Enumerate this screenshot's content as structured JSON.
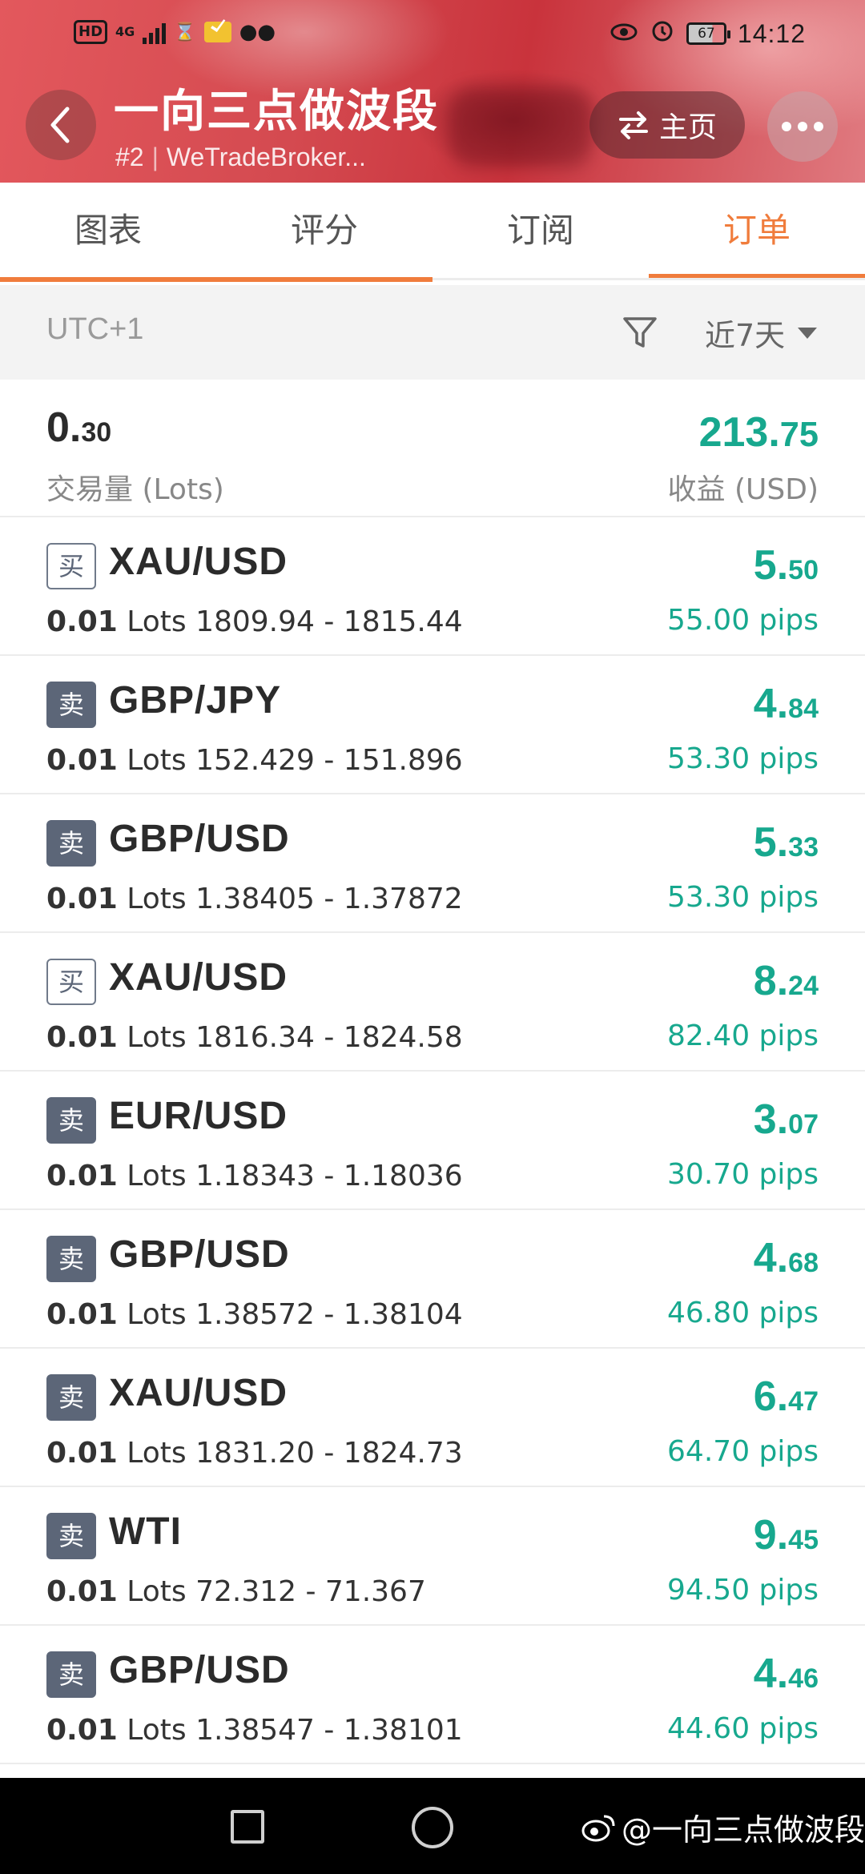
{
  "status_bar": {
    "hd": "HD",
    "network": "4G",
    "battery": "67",
    "time": "14:12"
  },
  "header": {
    "title": "一向三点做波段",
    "rank": "#2",
    "broker": "WeTradeBroker...",
    "home_label": "主页"
  },
  "tabs": [
    {
      "label": "图表",
      "active": false
    },
    {
      "label": "评分",
      "active": false
    },
    {
      "label": "订阅",
      "active": false
    },
    {
      "label": "订单",
      "active": true
    }
  ],
  "filter": {
    "timezone": "UTC+1",
    "period": "近7天"
  },
  "summary": {
    "lots_int": "0.",
    "lots_dec": "30",
    "lots_label": "交易量 (Lots)",
    "profit_int": "213.",
    "profit_dec": "75",
    "profit_label": "收益 (USD)"
  },
  "orders": [
    {
      "side": "买",
      "type": "buy",
      "symbol": "XAU/USD",
      "lots": "0.01",
      "lots_unit": "Lots",
      "range": "1809.94 - 1815.44",
      "profit_int": "5.",
      "profit_dec": "50",
      "pips": "55.00 pips"
    },
    {
      "side": "卖",
      "type": "sell",
      "symbol": "GBP/JPY",
      "lots": "0.01",
      "lots_unit": "Lots",
      "range": "152.429 - 151.896",
      "profit_int": "4.",
      "profit_dec": "84",
      "pips": "53.30 pips"
    },
    {
      "side": "卖",
      "type": "sell",
      "symbol": "GBP/USD",
      "lots": "0.01",
      "lots_unit": "Lots",
      "range": "1.38405 - 1.37872",
      "profit_int": "5.",
      "profit_dec": "33",
      "pips": "53.30 pips"
    },
    {
      "side": "买",
      "type": "buy",
      "symbol": "XAU/USD",
      "lots": "0.01",
      "lots_unit": "Lots",
      "range": "1816.34 - 1824.58",
      "profit_int": "8.",
      "profit_dec": "24",
      "pips": "82.40 pips"
    },
    {
      "side": "卖",
      "type": "sell",
      "symbol": "EUR/USD",
      "lots": "0.01",
      "lots_unit": "Lots",
      "range": "1.18343 - 1.18036",
      "profit_int": "3.",
      "profit_dec": "07",
      "pips": "30.70 pips"
    },
    {
      "side": "卖",
      "type": "sell",
      "symbol": "GBP/USD",
      "lots": "0.01",
      "lots_unit": "Lots",
      "range": "1.38572 - 1.38104",
      "profit_int": "4.",
      "profit_dec": "68",
      "pips": "46.80 pips"
    },
    {
      "side": "卖",
      "type": "sell",
      "symbol": "XAU/USD",
      "lots": "0.01",
      "lots_unit": "Lots",
      "range": "1831.20 - 1824.73",
      "profit_int": "6.",
      "profit_dec": "47",
      "pips": "64.70 pips"
    },
    {
      "side": "卖",
      "type": "sell",
      "symbol": "WTI",
      "lots": "0.01",
      "lots_unit": "Lots",
      "range": "72.312 - 71.367",
      "profit_int": "9.",
      "profit_dec": "45",
      "pips": "94.50 pips"
    },
    {
      "side": "卖",
      "type": "sell",
      "symbol": "GBP/USD",
      "lots": "0.01",
      "lots_unit": "Lots",
      "range": "1.38547 - 1.38101",
      "profit_int": "4.",
      "profit_dec": "46",
      "pips": "44.60 pips"
    }
  ],
  "watermark": "@一向三点做波段",
  "colors": {
    "accent": "#f07c3c",
    "profit": "#17a88e",
    "badge": "#5c6678"
  }
}
